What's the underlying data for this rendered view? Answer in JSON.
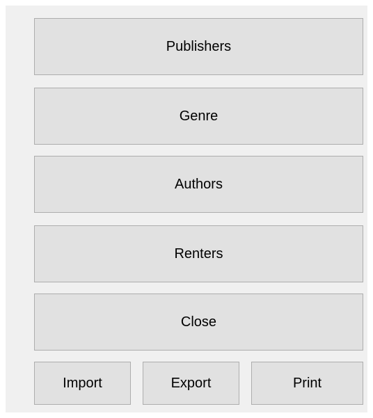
{
  "window": {
    "buttons": {
      "publishers": "Publishers",
      "genre": "Genre",
      "authors": "Authors",
      "renters": "Renters",
      "close": "Close",
      "import": "Import",
      "export": "Export",
      "print": "Print"
    }
  },
  "colors": {
    "window_background": "#f0f0f0",
    "button_face": "#e1e1e1",
    "button_border": "#adadad"
  }
}
